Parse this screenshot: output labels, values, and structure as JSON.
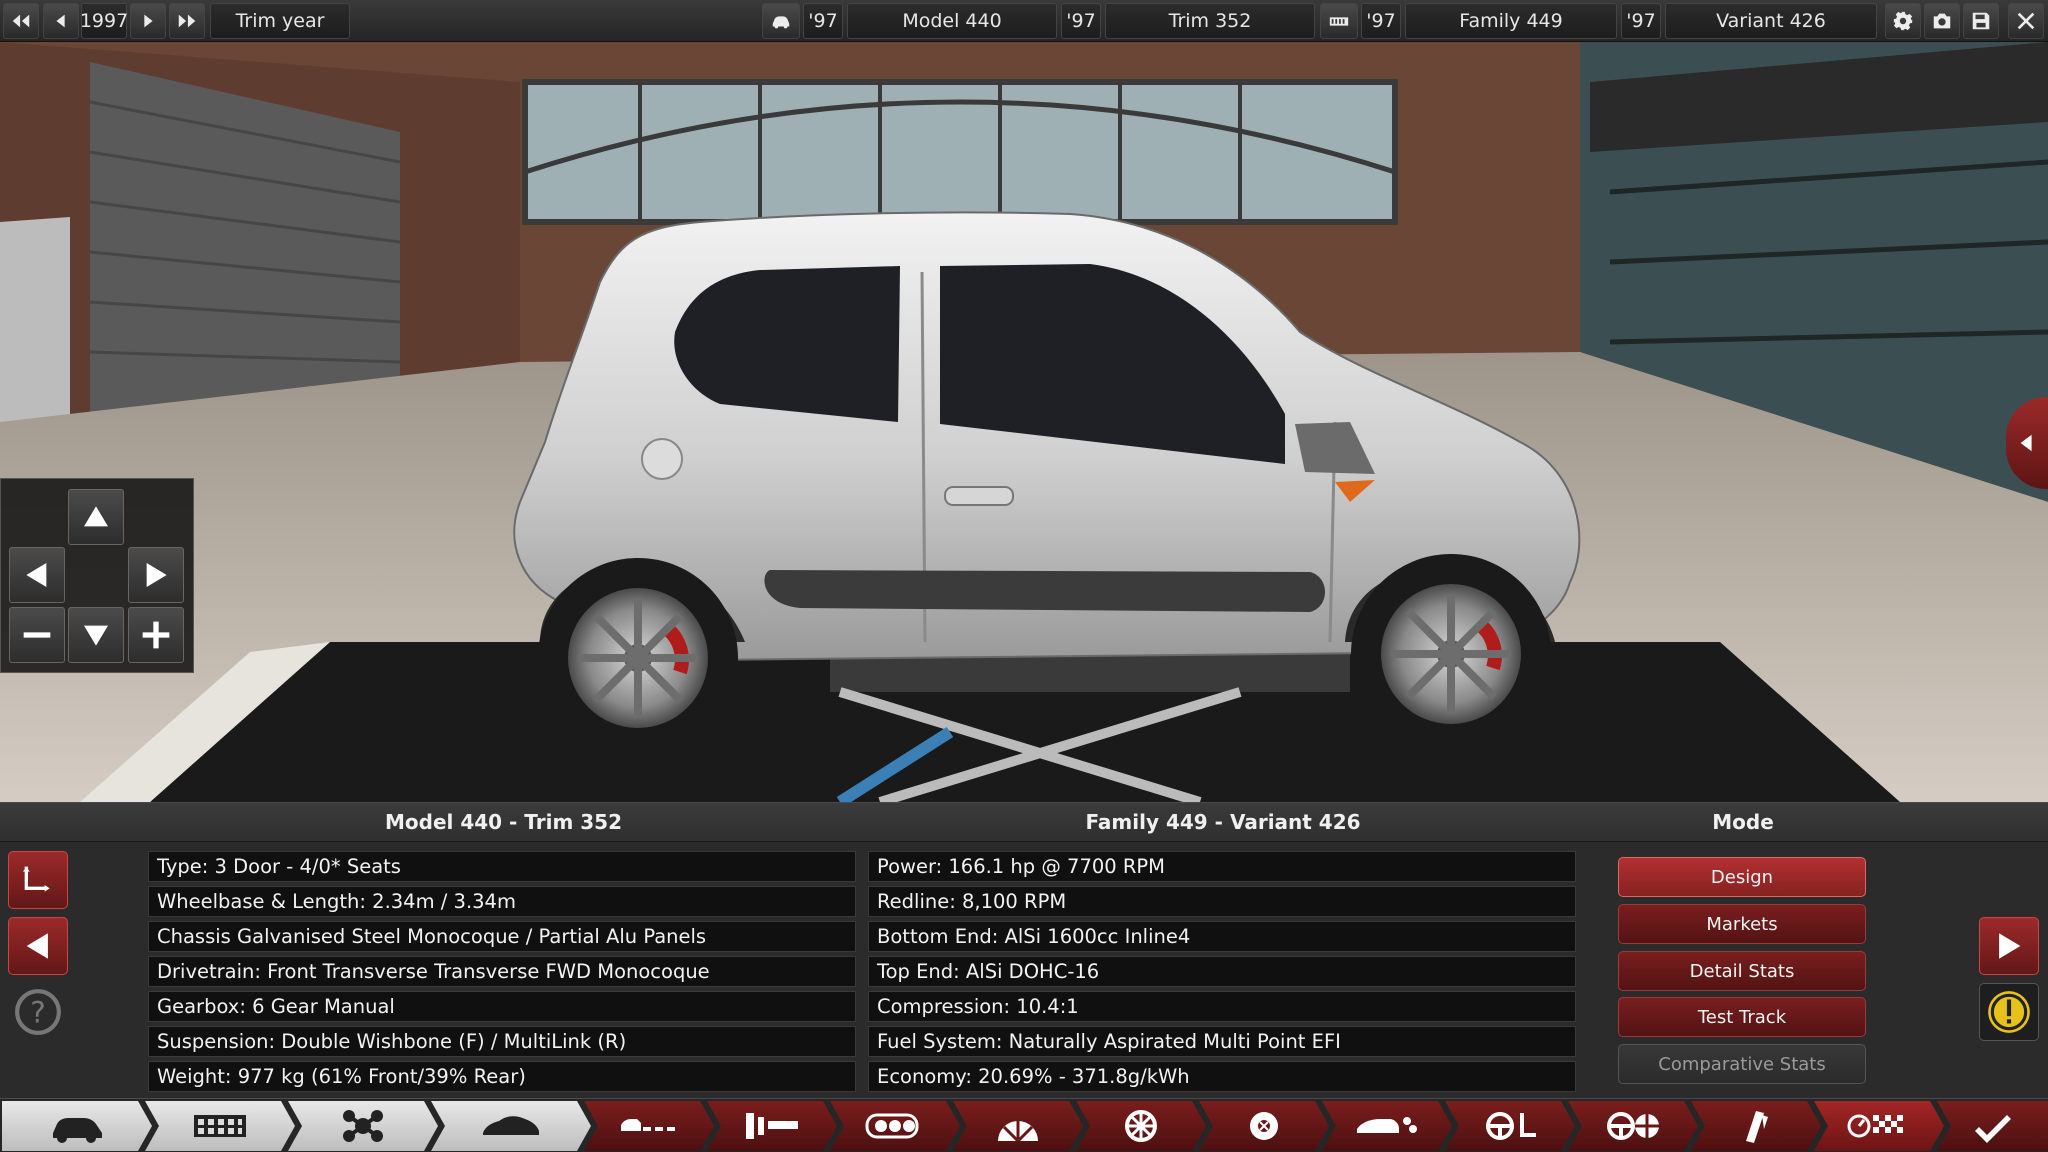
{
  "topbar": {
    "year": "1997",
    "trim_year_label": "Trim year",
    "model_year": "'97",
    "model_name": "Model 440",
    "trim_year": "'97",
    "trim_name": "Trim 352",
    "family_year": "'97",
    "family_name": "Family 449",
    "variant_year": "'97",
    "variant_name": "Variant 426"
  },
  "model_panel": {
    "title": "Model 440 - Trim 352",
    "rows": [
      "Type: 3 Door - 4/0* Seats",
      "Wheelbase & Length: 2.34m / 3.34m",
      "Chassis Galvanised Steel Monocoque / Partial Alu Panels",
      "Drivetrain: Front Transverse Transverse FWD Monocoque",
      "Gearbox: 6 Gear Manual",
      "Suspension: Double Wishbone (F) / MultiLink (R)",
      "Weight: 977 kg (61% Front/39% Rear)"
    ]
  },
  "engine_panel": {
    "title": "Family 449 - Variant 426",
    "rows": [
      "Power: 166.1 hp @ 7700 RPM",
      "Redline:  8,100 RPM",
      "Bottom End: AlSi 1600cc Inline4",
      "Top End: AlSi DOHC-16",
      "Compression: 10.4:1",
      "Fuel System: Naturally Aspirated Multi Point EFI",
      "Economy: 20.69% - 371.8g/kWh"
    ]
  },
  "mode_panel": {
    "title": "Mode",
    "buttons": [
      "Design",
      "Markets",
      "Detail Stats",
      "Test Track",
      "Comparative Stats"
    ]
  },
  "colors": {
    "accent_red": "#a12828",
    "panel_bg": "#2b2b2b",
    "row_bg": "#101010",
    "warning_yellow": "#e8c21a"
  },
  "icons": {
    "topbar": [
      "rewind-icon",
      "prev-icon",
      "next-icon",
      "fast-forward-icon",
      "car-icon",
      "engine-icon",
      "gear-icon",
      "camera-icon",
      "save-icon",
      "close-icon"
    ],
    "camera_pad": [
      "arrow-up-icon",
      "arrow-left-icon",
      "arrow-right-icon",
      "arrow-down-icon",
      "minus-icon",
      "plus-icon"
    ],
    "side": [
      "corner-icon",
      "back-arrow-icon",
      "help-icon",
      "forward-arrow-icon",
      "warning-icon"
    ],
    "toolbar": [
      "car-icon",
      "chassis-icon",
      "suspension-icon",
      "body-icon",
      "trims-icon",
      "interior-icon",
      "engine-icon",
      "turbo-icon",
      "wheels-icon",
      "brakes-icon",
      "aero-icon",
      "steering-icon",
      "tyres-icon",
      "fuel-icon",
      "test-flag-icon",
      "check-icon"
    ]
  }
}
